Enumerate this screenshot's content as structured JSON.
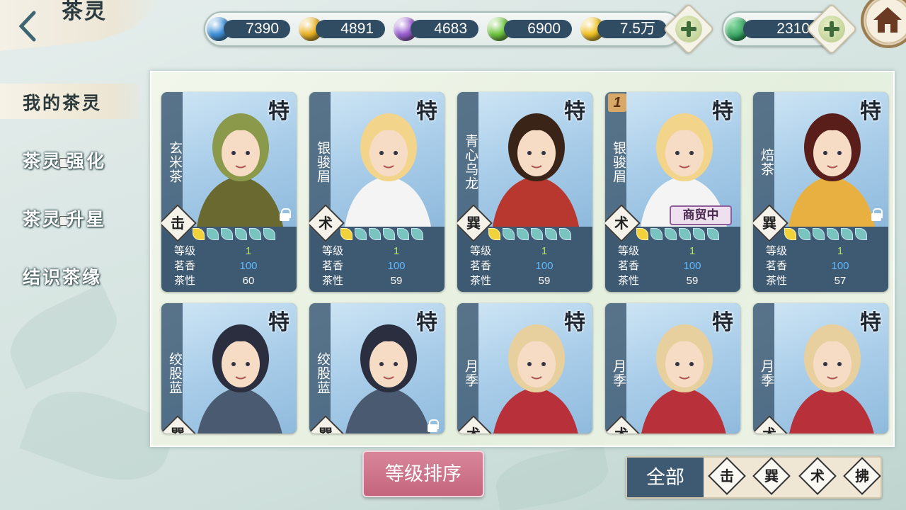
{
  "header": {
    "title": "茶灵",
    "back_icon": "chevron-left-icon",
    "home_icon": "house-icon"
  },
  "resources": [
    {
      "icon": "blue-gem-icon",
      "color": "#3c8fd8",
      "value": "7390"
    },
    {
      "icon": "gold-gem-icon",
      "color": "#e8b020",
      "value": "4891"
    },
    {
      "icon": "purple-gem-icon",
      "color": "#9a5fd0",
      "value": "4683"
    },
    {
      "icon": "green-gem-icon",
      "color": "#6cc43a",
      "value": "6900"
    },
    {
      "icon": "gold-coin-icon",
      "color": "#f0c020",
      "value": "7.5万"
    }
  ],
  "special_resource": {
    "icon": "jade-icon",
    "color": "#2e9a5a",
    "value": "2310"
  },
  "sidebar": {
    "items": [
      {
        "label": "我的茶灵",
        "active": true
      },
      {
        "label_a": "茶灵",
        "label_b": "强化",
        "locked": true
      },
      {
        "label_a": "茶灵",
        "label_b": "升星",
        "locked": true
      },
      {
        "label": "结识茶缘"
      }
    ]
  },
  "stat_labels": {
    "level": "等级",
    "fragrance": "茗香",
    "nature": "茶性"
  },
  "cards": [
    {
      "name": "玄米茶",
      "tag": "特",
      "faction": "击",
      "leaves_on": 1,
      "level": "1",
      "fragrance": "100",
      "nature": "60",
      "locked": true
    },
    {
      "name": "银骏眉",
      "tag": "特",
      "faction": "术",
      "leaves_on": 1,
      "level": "1",
      "fragrance": "100",
      "nature": "59",
      "locked": false
    },
    {
      "name": "青心乌龙",
      "tag": "特",
      "faction": "巽",
      "leaves_on": 1,
      "level": "1",
      "fragrance": "100",
      "nature": "59",
      "locked": false
    },
    {
      "name": "银骏眉",
      "tag": "特",
      "faction": "术",
      "leaves_on": 1,
      "level": "1",
      "fragrance": "100",
      "nature": "59",
      "locked": false,
      "number": "1",
      "status": "商贸中"
    },
    {
      "name": "焙茶",
      "tag": "特",
      "faction": "巽",
      "leaves_on": 1,
      "level": "1",
      "fragrance": "100",
      "nature": "57",
      "locked": true
    },
    {
      "name": "绞股蓝",
      "tag": "特",
      "faction": "巽",
      "locked": false
    },
    {
      "name": "绞股蓝",
      "tag": "特",
      "faction": "巽",
      "locked": true
    },
    {
      "name": "月季",
      "tag": "特",
      "faction": "术",
      "locked": false
    },
    {
      "name": "月季",
      "tag": "特",
      "faction": "术",
      "locked": false
    },
    {
      "name": "月季",
      "tag": "特",
      "faction": "术",
      "locked": false
    }
  ],
  "sort_button": "等级排序",
  "filter": {
    "all": "全部",
    "options": [
      "击",
      "巽",
      "术",
      "拂"
    ]
  }
}
